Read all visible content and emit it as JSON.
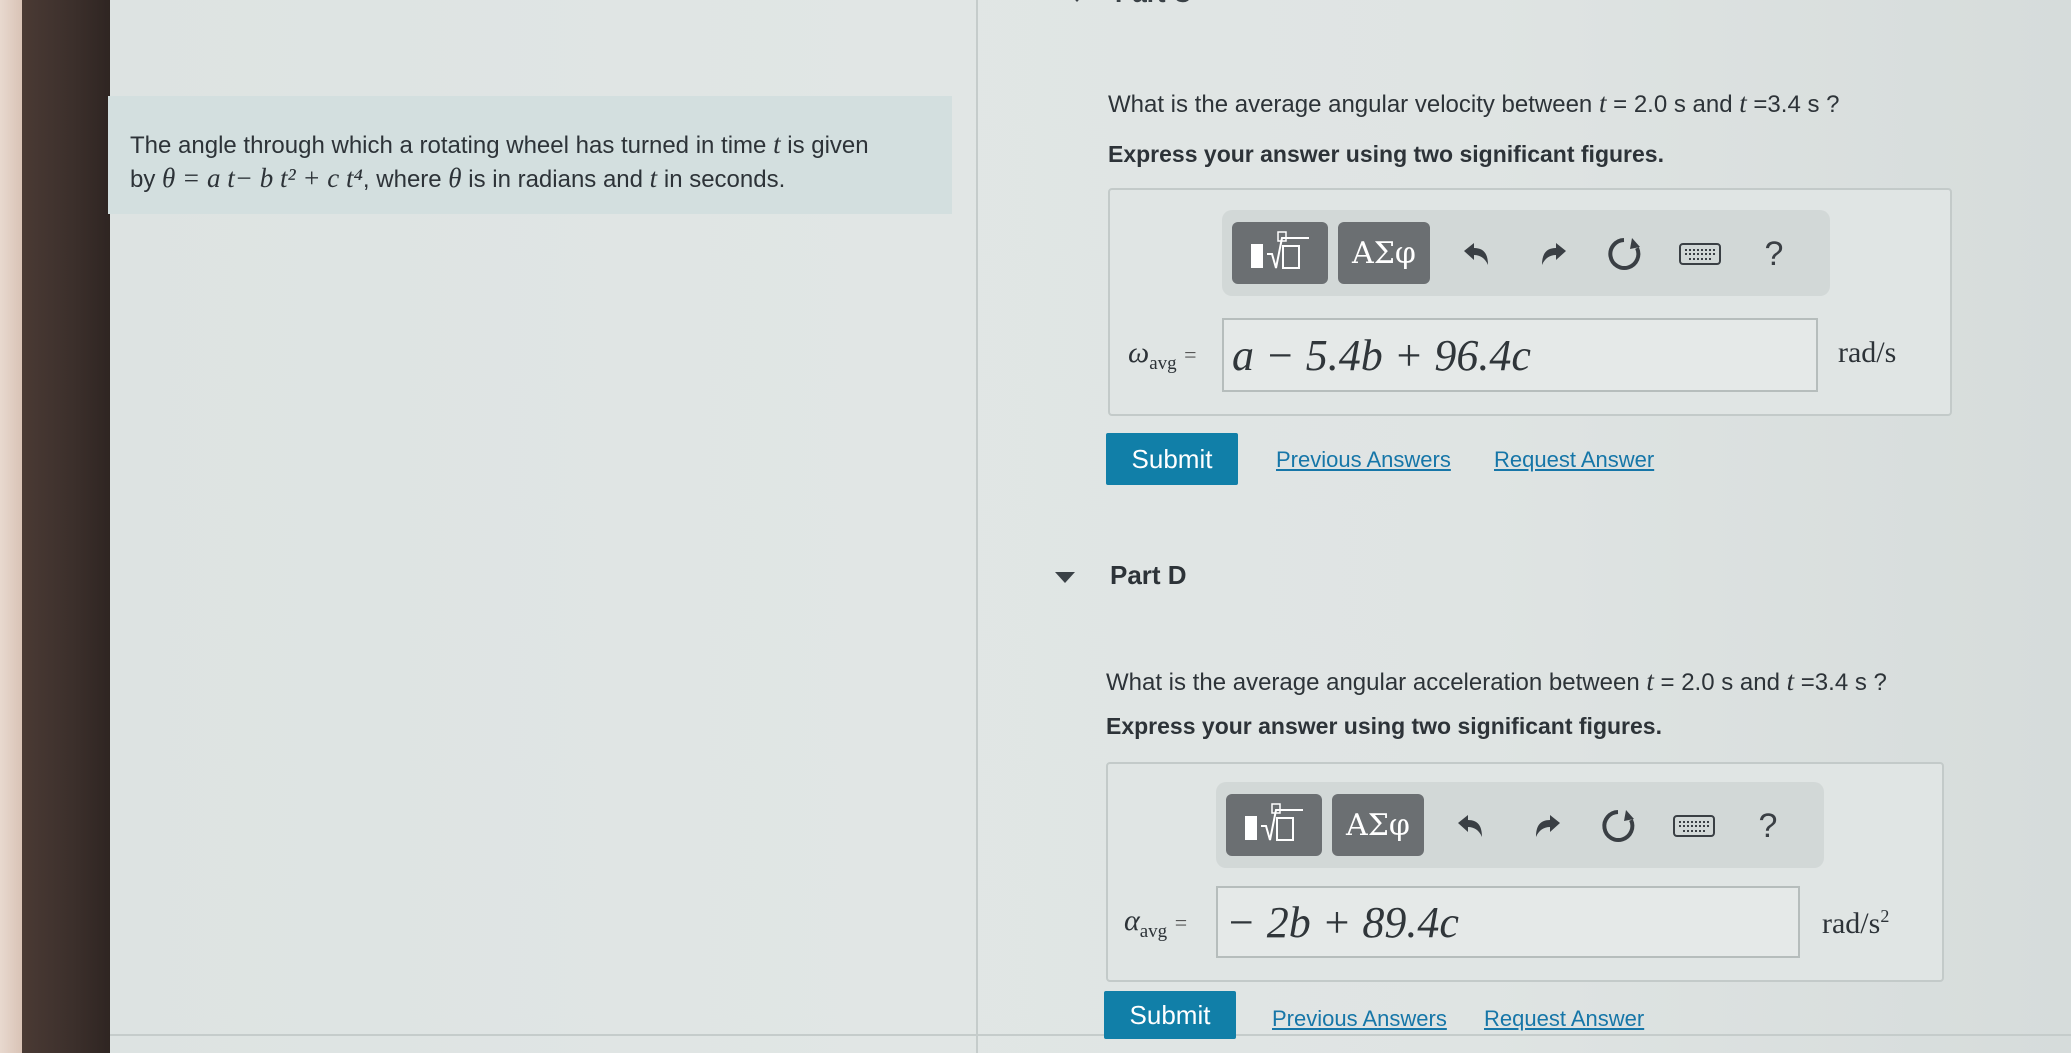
{
  "part_c": {
    "header": "Part C",
    "question_prefix": "What is the average angular velocity between ",
    "question_mid": " = 2.0 s and ",
    "question_suffix": " =3.4 s ?",
    "var_t": "t",
    "instruction": "Express your answer using two significant figures.",
    "lhs_symbol": "ω",
    "lhs_sub": "avg",
    "lhs_eq": "=",
    "answer_value": "a − 5.4b + 96.4c",
    "unit": "rad/s",
    "submit_label": "Submit",
    "previous_answers_label": "Previous Answers",
    "request_answer_label": "Request Answer"
  },
  "problem": {
    "line1_prefix": "The angle through which a rotating wheel has turned in time ",
    "line1_var": "t",
    "line1_suffix": " is given",
    "line2_prefix": "by ",
    "equation": "θ = a t− b t² + c t⁴",
    "line2_mid": ", where ",
    "theta": "θ",
    "line2_mid2": " is in radians and ",
    "t": "t",
    "line2_suffix": " in seconds."
  },
  "part_d": {
    "title": "Part D",
    "question_prefix": "What is the average angular acceleration between ",
    "question_mid": " = 2.0 s and ",
    "question_suffix": " =3.4 s ?",
    "var_t": "t",
    "instruction": "Express your answer using two significant figures.",
    "lhs_symbol": "α",
    "lhs_sub": "avg",
    "lhs_eq": "=",
    "answer_value": "− 2b + 89.4c",
    "unit_base": "rad/s",
    "unit_exp": "2",
    "submit_label": "Submit",
    "previous_answers_label": "Previous Answers",
    "request_answer_label": "Request Answer"
  },
  "toolbar": {
    "greek_label": "ΑΣφ",
    "help_label": "?",
    "icons": [
      "templates-icon",
      "greek-symbols-icon",
      "undo-icon",
      "redo-icon",
      "reset-icon",
      "keyboard-icon",
      "help-icon"
    ]
  }
}
